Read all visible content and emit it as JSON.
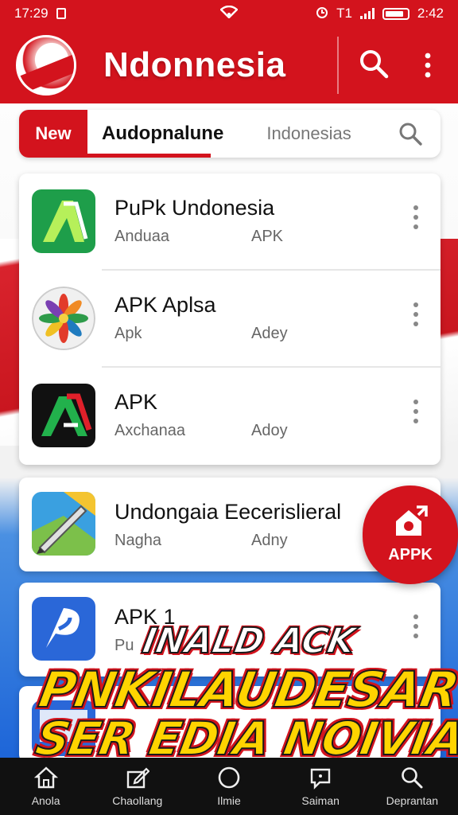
{
  "status_bar": {
    "time_left": "17:29",
    "carrier": "T1",
    "time_right": "2:42"
  },
  "app_bar": {
    "title": "Ndonnesia"
  },
  "tabs": {
    "new_label": "New",
    "active_label": "Audopnalune",
    "search_placeholder": "Indonesias"
  },
  "list": [
    {
      "title": "PuPk Undonesia",
      "sub1": "Anduaa",
      "sub2": "APK",
      "icon": "green-a-icon"
    },
    {
      "title": "APK Aplsa",
      "sub1": "Apk",
      "sub2": "Adey",
      "icon": "flower-icon"
    },
    {
      "title": "APK",
      "sub1": "Axchanaa",
      "sub2": "Adoy",
      "icon": "black-a-icon"
    },
    {
      "title": "Undongaia Eecerislieral",
      "sub1": "Nagha",
      "sub2": "Adny",
      "icon": "maps-pen-icon"
    },
    {
      "title": "APK 1",
      "sub1": "Pu",
      "sub2": "",
      "icon": "blue-p-icon"
    }
  ],
  "fab": {
    "label": "APPK"
  },
  "promo": {
    "line1": "INALD ACK",
    "line2": "PNKILAUDESAR",
    "line3": "SER EDIA NOIVIAP!"
  },
  "bottom_nav": [
    {
      "label": "Anola",
      "icon": "home-icon"
    },
    {
      "label": "Chaollang",
      "icon": "edit-icon"
    },
    {
      "label": "Ilmie",
      "icon": "circle-icon"
    },
    {
      "label": "Saiman",
      "icon": "chat-icon"
    },
    {
      "label": "Deprantan",
      "icon": "search-icon"
    }
  ],
  "colors": {
    "brand_red": "#d3131d",
    "nav_bg": "#111111",
    "promo_yellow": "#ffd400"
  }
}
